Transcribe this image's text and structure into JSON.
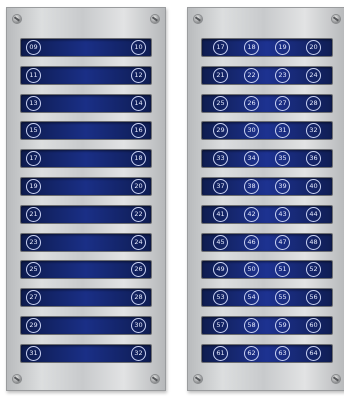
{
  "left_panel": {
    "rows": [
      [
        "09",
        "10"
      ],
      [
        "11",
        "12"
      ],
      [
        "13",
        "14"
      ],
      [
        "15",
        "16"
      ],
      [
        "17",
        "18"
      ],
      [
        "19",
        "20"
      ],
      [
        "21",
        "22"
      ],
      [
        "23",
        "24"
      ],
      [
        "25",
        "26"
      ],
      [
        "27",
        "28"
      ],
      [
        "29",
        "30"
      ],
      [
        "31",
        "32"
      ]
    ]
  },
  "right_panel": {
    "rows": [
      [
        "17",
        "18",
        "19",
        "20"
      ],
      [
        "21",
        "22",
        "23",
        "24"
      ],
      [
        "25",
        "26",
        "27",
        "28"
      ],
      [
        "29",
        "30",
        "31",
        "32"
      ],
      [
        "33",
        "34",
        "35",
        "36"
      ],
      [
        "37",
        "38",
        "39",
        "40"
      ],
      [
        "41",
        "42",
        "43",
        "44"
      ],
      [
        "45",
        "46",
        "47",
        "48"
      ],
      [
        "49",
        "50",
        "51",
        "52"
      ],
      [
        "53",
        "54",
        "55",
        "56"
      ],
      [
        "57",
        "58",
        "59",
        "60"
      ],
      [
        "61",
        "62",
        "63",
        "64"
      ]
    ]
  }
}
